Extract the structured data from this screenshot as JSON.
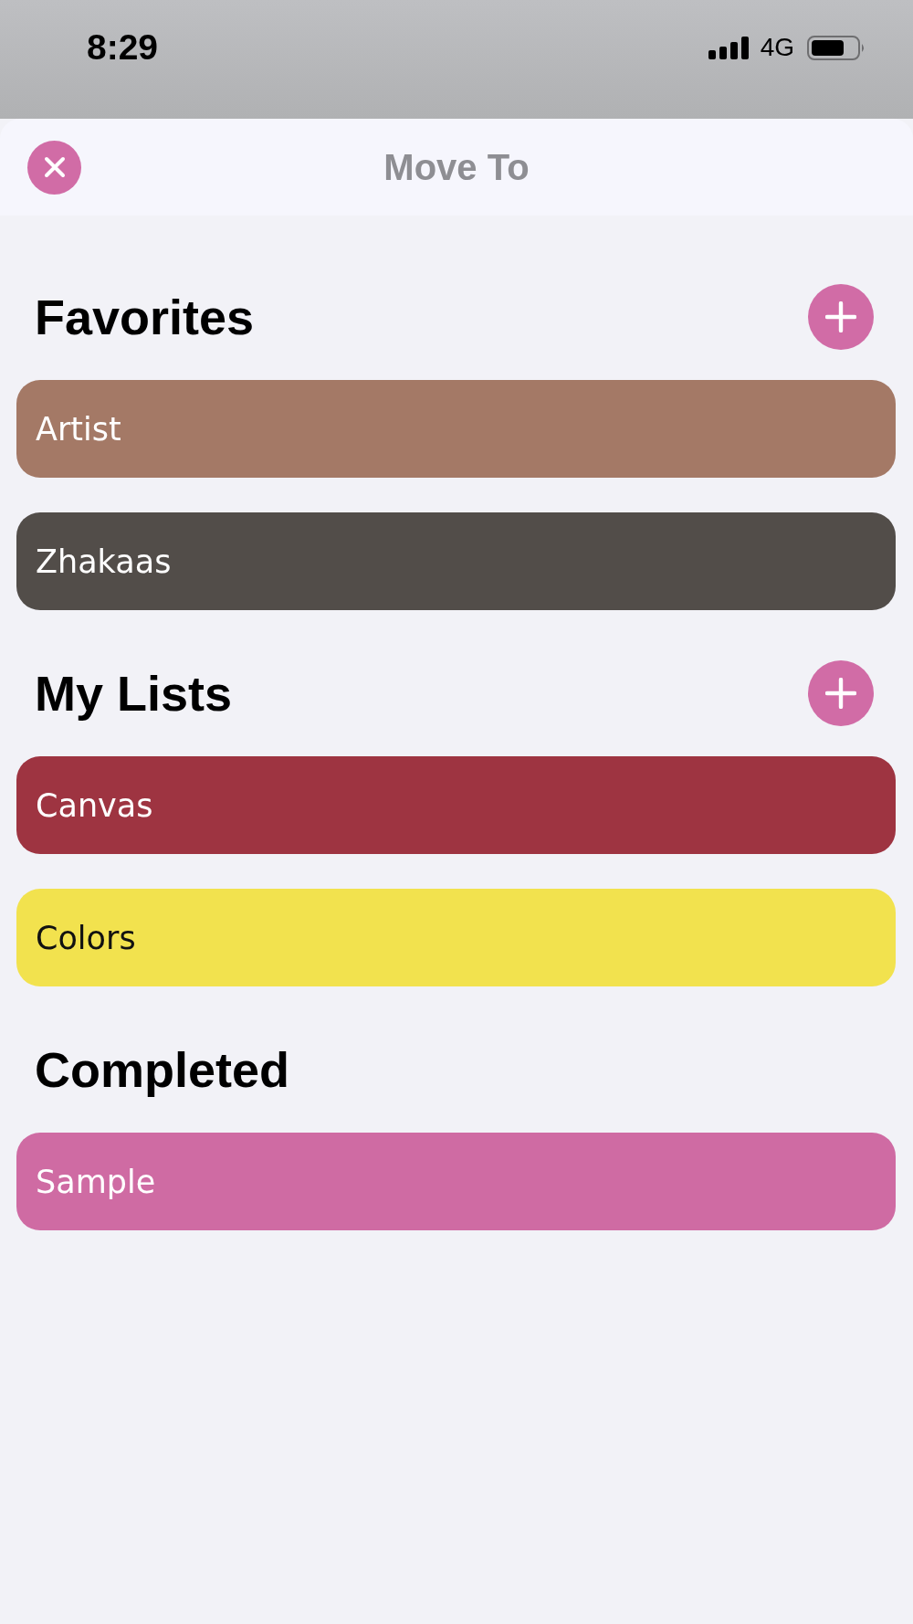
{
  "status_bar": {
    "time": "8:29",
    "network": "4G"
  },
  "header": {
    "title": "Move To"
  },
  "sections": [
    {
      "title": "Favorites",
      "add_button": true,
      "lists": [
        {
          "name": "Artist",
          "color": "#a47966"
        },
        {
          "name": "Zhakaas",
          "color": "#524d49"
        }
      ]
    },
    {
      "title": "My Lists",
      "add_button": true,
      "lists": [
        {
          "name": "Canvas",
          "color": "#9e3441"
        },
        {
          "name": "Colors",
          "color": "#f2e24e"
        }
      ]
    },
    {
      "title": "Completed",
      "add_button": false,
      "lists": [
        {
          "name": "Sample",
          "color": "#cf6ba3"
        }
      ]
    }
  ]
}
